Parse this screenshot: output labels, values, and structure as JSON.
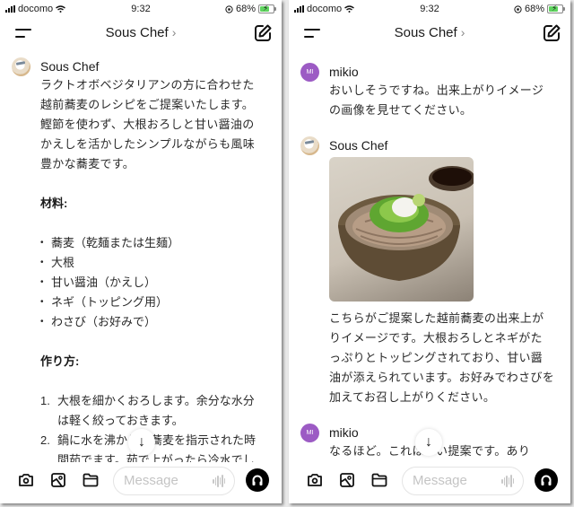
{
  "status_bar": {
    "carrier": "docomo",
    "time": "9:32",
    "battery_percent": "68%"
  },
  "nav": {
    "title": "Sous Chef",
    "title_chevron": "›",
    "menu_icon": "hamburger-menu-icon",
    "edit_icon": "compose-icon"
  },
  "composer": {
    "placeholder": "Message",
    "icons": [
      "camera-icon",
      "image-icon",
      "folder-icon",
      "waveform-icon",
      "headphones-icon"
    ]
  },
  "scroll_down_glyph": "↓",
  "screen1": {
    "messages": [
      {
        "sender": "Sous Chef",
        "avatar": "chef-avatar",
        "intro": "ラクトオボベジタリアンの方に合わせた越前蕎麦のレシピをご提案いたします。鰹節を使わず、大根おろしと甘い醤油のかえしを活かしたシンプルながらも風味豊かな蕎麦です。",
        "ingredients_heading": "材料:",
        "ingredients": [
          "蕎麦（乾麺または生麺）",
          "大根",
          "甘い醤油（かえし）",
          "ネギ（トッピング用）",
          "わさび（お好みで）"
        ],
        "steps_heading": "作り方:",
        "steps": [
          {
            "num": "1.",
            "text": "大根を細かくおろします。余分な水分は軽く絞っておきます。"
          },
          {
            "num": "2.",
            "text": "鍋に水を沸かし、蕎麦を指示された時間茹でます。茹で上がったら冷水でし"
          }
        ]
      }
    ]
  },
  "screen2": {
    "messages": [
      {
        "sender": "mikio",
        "avatar_initials": "MI",
        "text": "おいしそうですね。出来上がりイメージの画像を見せてください。"
      },
      {
        "sender": "Sous Chef",
        "avatar": "chef-avatar",
        "image": "soba-bowl-image",
        "text": "こちらがご提案した越前蕎麦の出来上がりイメージです。大根おろしとネギがたっぷりとトッピングされており、甘い醤油が添えられています。お好みでわさびを加えてお召し上がりください。"
      },
      {
        "sender": "mikio",
        "avatar_initials": "MI",
        "text": "なるほど。これはいい提案です。あり"
      }
    ]
  }
}
